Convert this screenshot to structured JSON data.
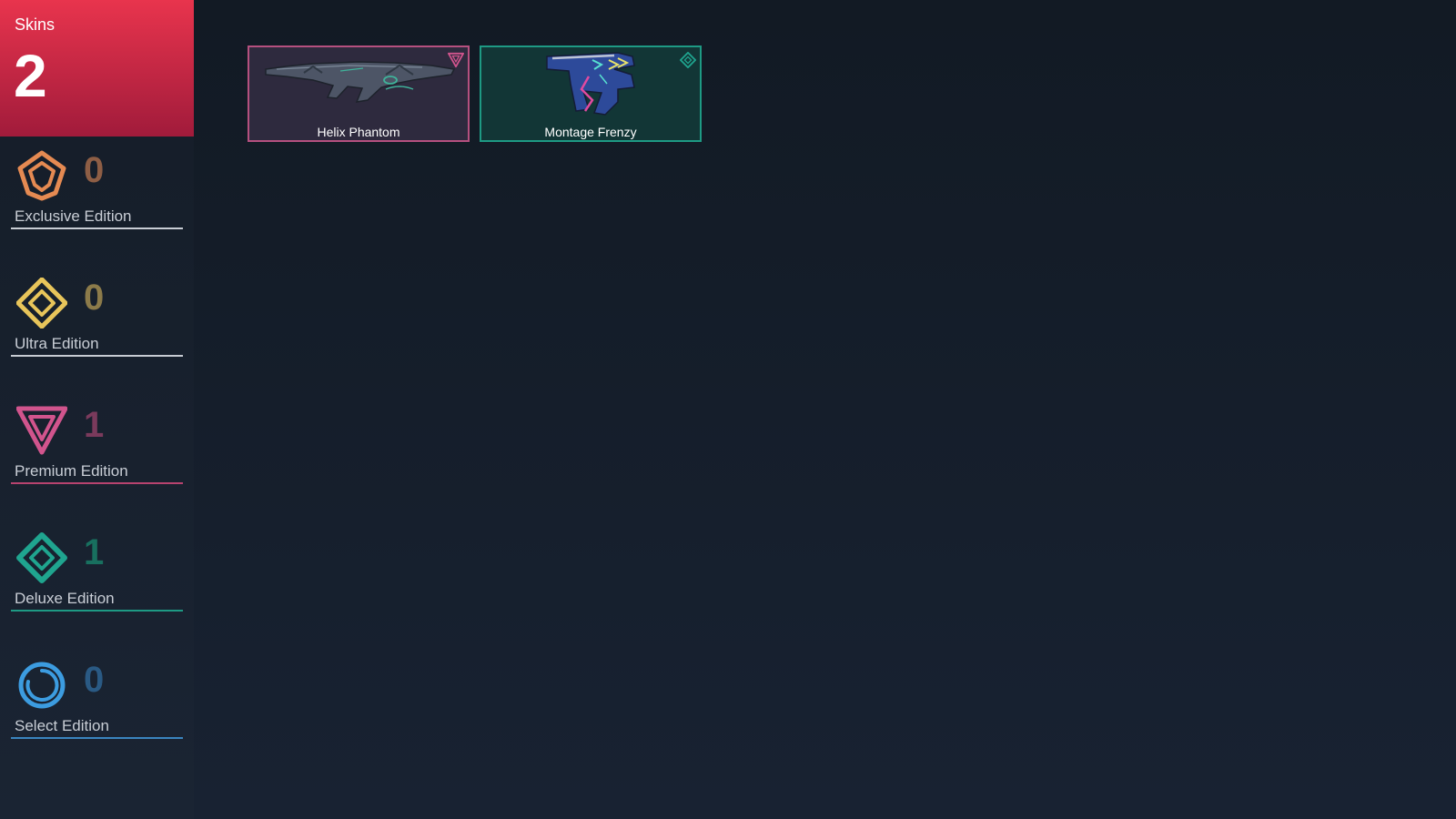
{
  "summary": {
    "label": "Skins",
    "count": "2"
  },
  "tiers": [
    {
      "name": "Exclusive Edition",
      "count": "0",
      "icon": "exclusive-edition-icon",
      "color": "#e58a52",
      "count_color": "#8e5e45",
      "line_color": "#c8cdd4"
    },
    {
      "name": "Ultra Edition",
      "count": "0",
      "icon": "ultra-edition-icon",
      "color": "#e8c55a",
      "count_color": "#8c7b4a",
      "line_color": "#c8cdd4"
    },
    {
      "name": "Premium Edition",
      "count": "1",
      "icon": "premium-edition-icon",
      "color": "#d1548d",
      "count_color": "#7a3a5c",
      "line_color": "#b8436f"
    },
    {
      "name": "Deluxe Edition",
      "count": "1",
      "icon": "deluxe-edition-icon",
      "color": "#1fa58f",
      "count_color": "#18705f",
      "line_color": "#1e9a84"
    },
    {
      "name": "Select Edition",
      "count": "0",
      "icon": "select-edition-icon",
      "color": "#3c9ce0",
      "count_color": "#2a5a84",
      "line_color": "#3a85bf"
    }
  ],
  "skins": [
    {
      "name": "Helix Phantom",
      "tier": "Premium Edition",
      "icon": "premium-edition-icon",
      "border_color": "#b5507f",
      "bg_color": "#2e2a3e"
    },
    {
      "name": "Montage Frenzy",
      "tier": "Deluxe Edition",
      "icon": "deluxe-edition-icon",
      "border_color": "#1e9a84",
      "bg_color": "#123636"
    }
  ]
}
